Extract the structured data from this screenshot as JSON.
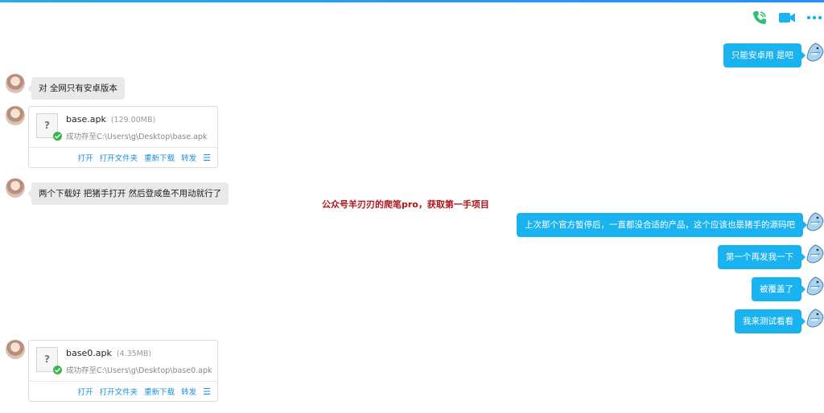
{
  "toolbar": {
    "phone_icon": "phone-icon",
    "video_icon": "video-call-icon",
    "more_icon": "more-icon",
    "accent": "#1ab3f0"
  },
  "messages": {
    "m1": "只能安卓用 是吧",
    "m2": "对 全网只有安卓版本",
    "m3": "两个下载好 把猪手打开 然后登咸鱼不用动就行了",
    "m4": "上次那个官方暂停后，一直都没合适的产品，这个应该也是猪手的源码吧",
    "m5": "第一个再发我一下",
    "m6": "被覆盖了",
    "m7": "我来测试看看"
  },
  "files": [
    {
      "name": "base.apk",
      "size": "(129.00MB)",
      "status": "成功存至C:\\Users\\g\\Desktop\\base.apk",
      "icon_glyph": "?",
      "actions": [
        "打开",
        "打开文件夹",
        "重新下载",
        "转发"
      ],
      "menu_glyph": "☰"
    },
    {
      "name": "base0.apk",
      "size": "(4.35MB)",
      "status": "成功存至C:\\Users\\g\\Desktop\\base0.apk",
      "icon_glyph": "?",
      "actions": [
        "打开",
        "打开文件夹",
        "重新下载",
        "转发"
      ],
      "menu_glyph": "☰"
    }
  ],
  "watermark": "公众号羊刃刃的爬笔pro，获取第一手项目",
  "colors": {
    "sent_bubble": "#1ab3f0",
    "received_bubble": "#e9e9eb",
    "link": "#1a8fd8",
    "watermark": "#b0141b"
  }
}
